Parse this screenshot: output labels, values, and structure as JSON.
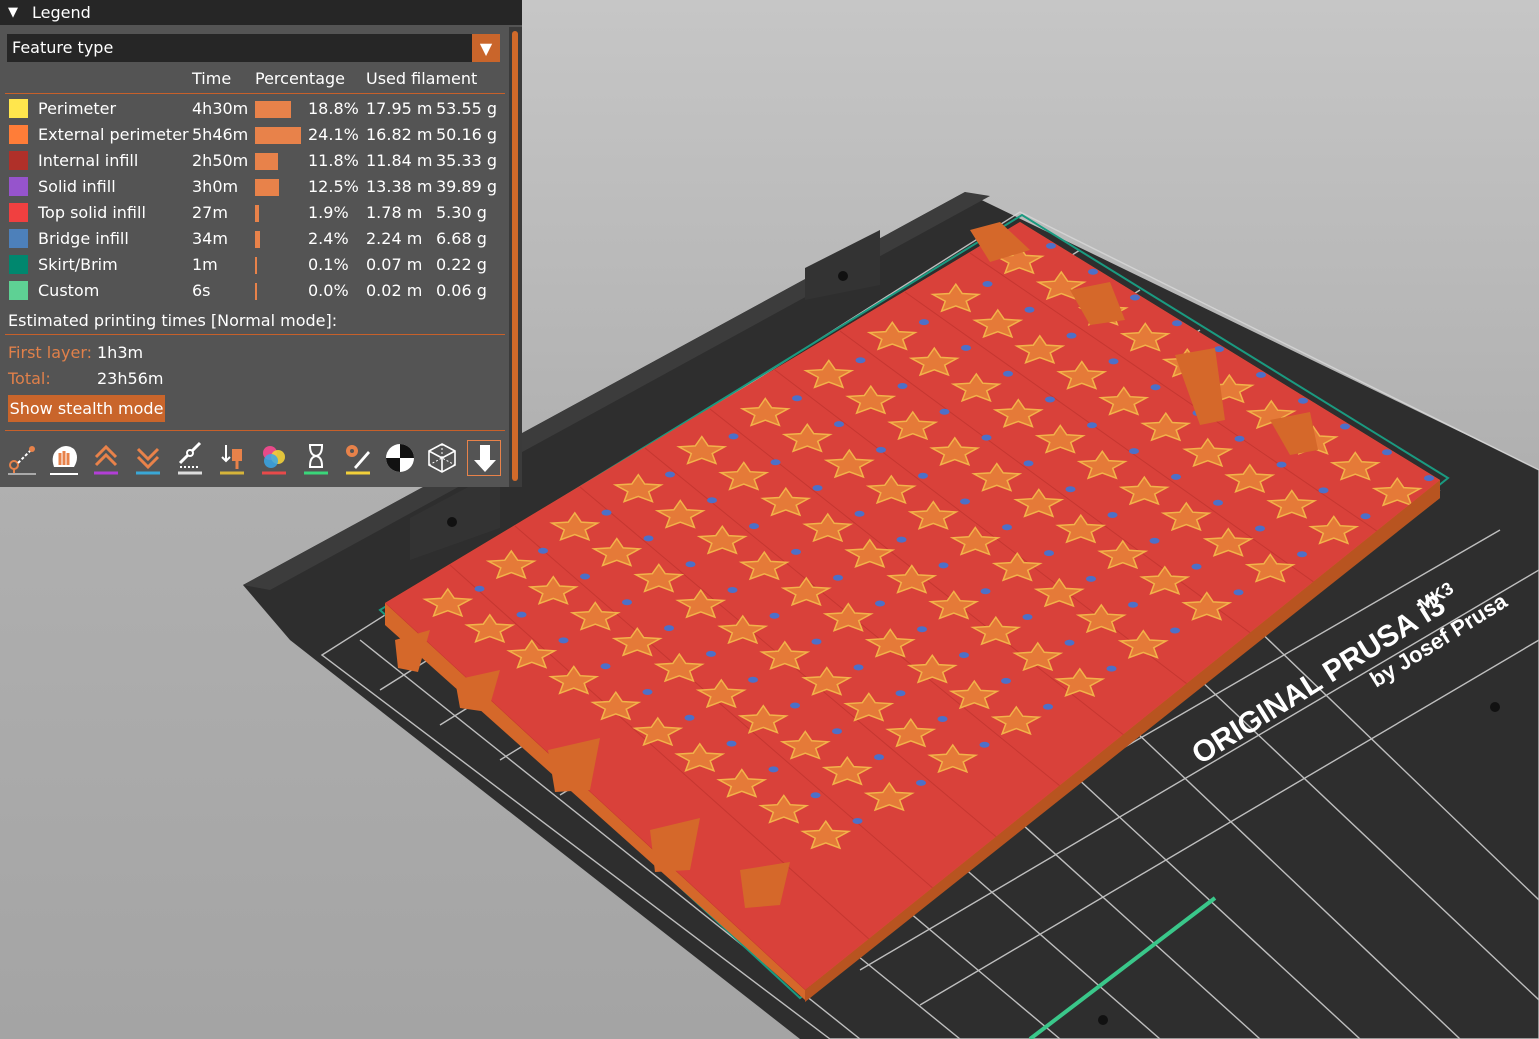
{
  "legend": {
    "title": "Legend",
    "view_type": "Feature type",
    "columns": [
      "Time",
      "Percentage",
      "Used filament"
    ],
    "rows": [
      {
        "label": "Perimeter",
        "color": "#ffe64d",
        "time": "4h30m",
        "percent": "18.8%",
        "percent_value": 18.8,
        "length": "17.95 m",
        "weight": "53.55 g"
      },
      {
        "label": "External perimeter",
        "color": "#ff7d38",
        "time": "5h46m",
        "percent": "24.1%",
        "percent_value": 24.1,
        "length": "16.82 m",
        "weight": "50.16 g"
      },
      {
        "label": "Internal infill",
        "color": "#b03029",
        "time": "2h50m",
        "percent": "11.8%",
        "percent_value": 11.8,
        "length": "11.84 m",
        "weight": "35.33 g"
      },
      {
        "label": "Solid infill",
        "color": "#9654cc",
        "time": "3h0m",
        "percent": "12.5%",
        "percent_value": 12.5,
        "length": "13.38 m",
        "weight": "39.89 g"
      },
      {
        "label": "Top solid infill",
        "color": "#f04040",
        "time": "27m",
        "percent": "1.9%",
        "percent_value": 1.9,
        "length": "1.78 m",
        "weight": "5.30 g"
      },
      {
        "label": "Bridge infill",
        "color": "#4d80ba",
        "time": "34m",
        "percent": "2.4%",
        "percent_value": 2.4,
        "length": "2.24 m",
        "weight": "6.68 g"
      },
      {
        "label": "Skirt/Brim",
        "color": "#00876e",
        "time": "1m",
        "percent": "0.1%",
        "percent_value": 0.1,
        "length": "0.07 m",
        "weight": "0.22 g"
      },
      {
        "label": "Custom",
        "color": "#5ed194",
        "time": "6s",
        "percent": "0.0%",
        "percent_value": 0.0,
        "length": "0.02 m",
        "weight": "0.06 g"
      }
    ],
    "estimated_title": "Estimated printing times [Normal mode]:",
    "first_layer_label": "First layer:",
    "first_layer_value": "1h3m",
    "total_label": "Total:",
    "total_value": "23h56m",
    "stealth_button": "Show stealth mode",
    "tools": [
      {
        "icon": "travel-icon"
      },
      {
        "icon": "wipe-icon"
      },
      {
        "icon": "retractions-icon"
      },
      {
        "icon": "deretractions-icon"
      },
      {
        "icon": "seams-icon"
      },
      {
        "icon": "tool-changes-icon"
      },
      {
        "icon": "color-changes-icon"
      },
      {
        "icon": "pause-icon"
      },
      {
        "icon": "custom-gcode-icon"
      },
      {
        "icon": "center-of-gravity-icon"
      },
      {
        "icon": "shells-icon"
      },
      {
        "icon": "tool-marker-icon"
      }
    ]
  },
  "bed": {
    "brand_text": "ORIGINAL PRUSA i3",
    "model_text": "MK3",
    "byline": "by Josef Prusa"
  },
  "colors": {
    "accent": "#c9652b",
    "panel": "#545454",
    "header": "#262626"
  }
}
